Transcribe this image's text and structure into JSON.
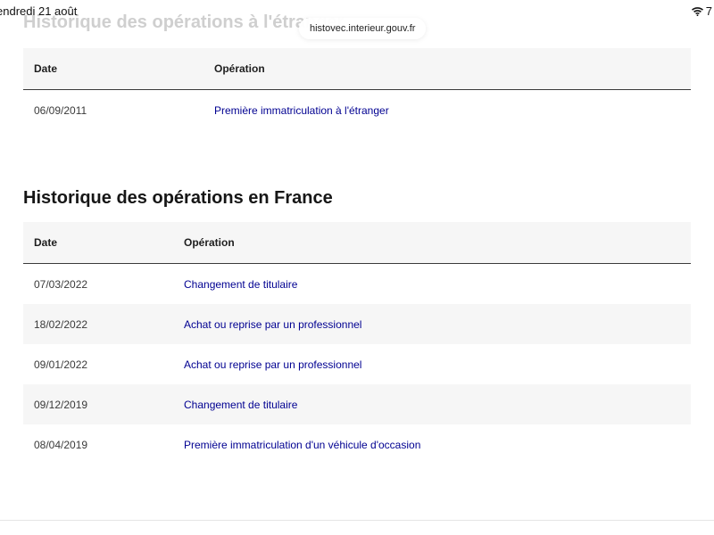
{
  "status_bar": {
    "time": "endredi 21 août",
    "battery": "7"
  },
  "browser": {
    "url": "histovec.interieur.gouv.fr"
  },
  "ghost_title": "Historique des opérations à l'étranger",
  "foreign_ops": {
    "header_date": "Date",
    "header_operation": "Opération",
    "rows": [
      {
        "date": "06/09/2011",
        "operation": "Première immatriculation à l'étranger"
      }
    ]
  },
  "france_ops": {
    "title": "Historique des opérations en France",
    "header_date": "Date",
    "header_operation": "Opération",
    "rows": [
      {
        "date": "07/03/2022",
        "operation": "Changement de titulaire"
      },
      {
        "date": "18/02/2022",
        "operation": "Achat ou reprise par un professionnel"
      },
      {
        "date": "09/01/2022",
        "operation": "Achat ou reprise par un professionnel"
      },
      {
        "date": "09/12/2019",
        "operation": "Changement de titulaire"
      },
      {
        "date": "08/04/2019",
        "operation": "Première immatriculation d'un véhicule d'occasion"
      }
    ]
  },
  "colors": {
    "link": "#000091",
    "header_bg": "#f6f6f6"
  }
}
